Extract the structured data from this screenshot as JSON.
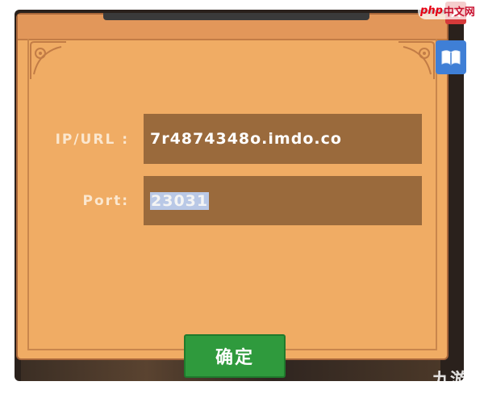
{
  "dialog": {
    "ip_label": "IP/URL :",
    "ip_value": "7r4874348o.imdo.co",
    "port_label": "Port:",
    "port_value": "23031",
    "confirm_label": "确定"
  },
  "side_buttons": {
    "close_icon": "close-icon",
    "book_icon": "book-icon"
  },
  "watermarks": {
    "top_right_php": "php",
    "top_right_cn": "中文网",
    "bottom_right": "九游"
  },
  "colors": {
    "panel": "#f0ac64",
    "field": "#9a6a3c",
    "confirm": "#2f9a3d",
    "selection": "#b9c8e6"
  }
}
